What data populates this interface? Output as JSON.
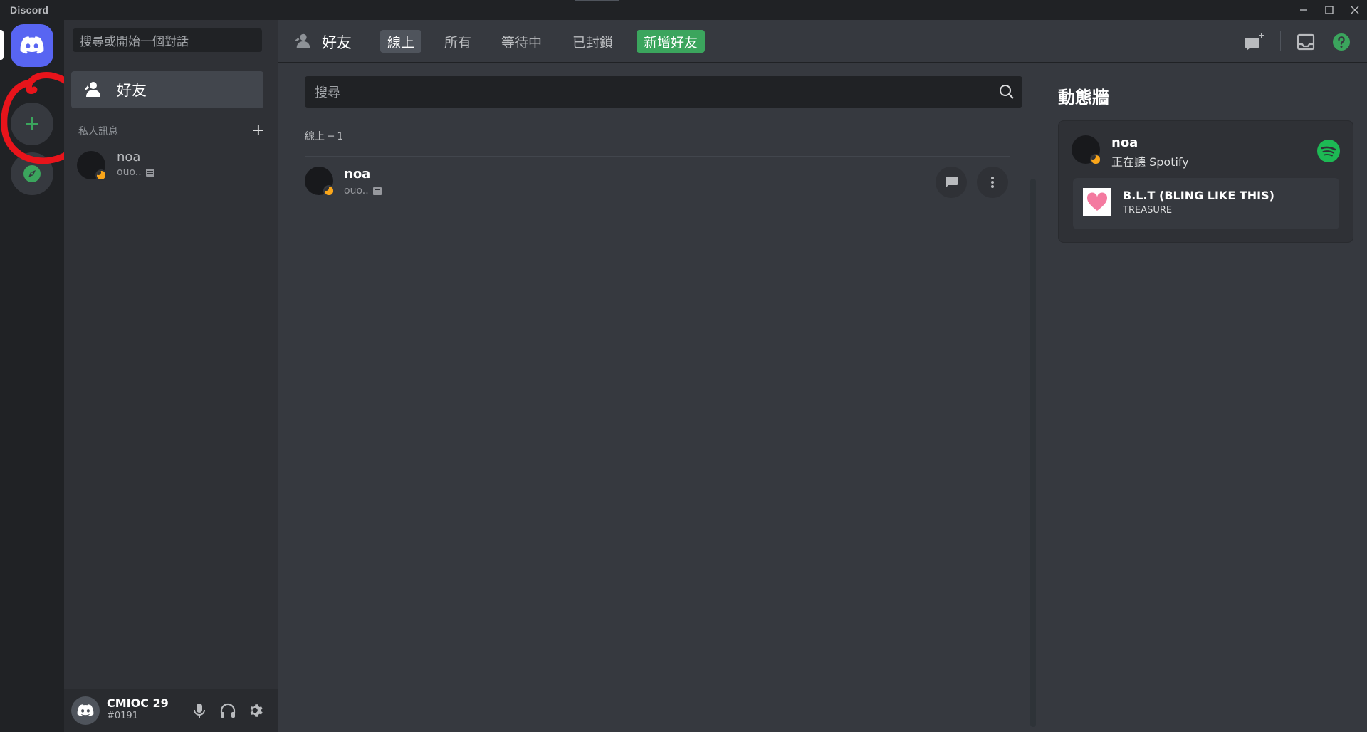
{
  "window": {
    "title": "Discord"
  },
  "dm_sidebar": {
    "search_placeholder": "搜尋或開始一個對話",
    "friends_label": "好友",
    "dm_header": "私人訊息",
    "dm_add_symbol": "+",
    "dms": [
      {
        "name": "noa",
        "status_text": "ouo..",
        "status": "idle"
      }
    ]
  },
  "user_panel": {
    "username": "CMIOC 29",
    "tag": "#0191"
  },
  "topbar": {
    "title": "好友",
    "tabs": [
      {
        "label": "線上",
        "active": true
      },
      {
        "label": "所有",
        "active": false
      },
      {
        "label": "等待中",
        "active": false
      },
      {
        "label": "已封鎖",
        "active": false
      }
    ],
    "add_friend_label": "新增好友",
    "icons": [
      "new-group-dm-icon",
      "inbox-icon",
      "help-icon"
    ]
  },
  "friends": {
    "search_placeholder": "搜尋",
    "online_header": "線上 ─ 1",
    "list": [
      {
        "name": "noa",
        "status_text": "ouo..",
        "status": "idle"
      }
    ]
  },
  "activity": {
    "title": "動態牆",
    "card": {
      "name": "noa",
      "activity_text": "正在聽 Spotify",
      "track_title": "B.L.T (BLING LIKE THIS)",
      "track_artist": "TREASURE"
    }
  },
  "annotations": {
    "red_circle_target": "add-server-button"
  },
  "colors": {
    "blurple": "#5865f2",
    "green": "#3ba55d",
    "idle": "#faa61a",
    "spotify": "#1db954",
    "annotation_red": "#e8141b"
  }
}
